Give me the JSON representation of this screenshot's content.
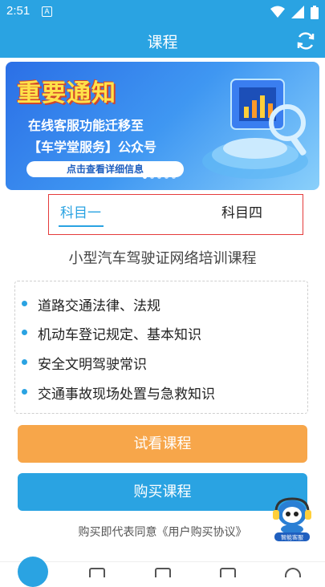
{
  "status_bar": {
    "time": "2:51",
    "notification_badge": "A",
    "icons": [
      "wifi-icon",
      "signal-icon",
      "battery-icon"
    ]
  },
  "app_bar": {
    "title": "课程",
    "refresh_icon": "refresh-icon"
  },
  "banner": {
    "headline": "重要通知",
    "line1": "在线客服功能迁移至",
    "line2": "【车学堂服务】公众号",
    "button_label": "点击查看详细信息",
    "slide_count": 5,
    "active_slide": 0
  },
  "tabs": [
    {
      "label": "科目一",
      "active": true
    },
    {
      "label": "科目四",
      "active": false
    }
  ],
  "course_title": "小型汽车驾驶证网络培训课程",
  "topics": [
    "道路交通法律、法规",
    "机动车登记规定、基本知识",
    "安全文明驾驶常识",
    "交通事故现场处置与急救知识"
  ],
  "buttons": {
    "trial": "试看课程",
    "buy": "购买课程"
  },
  "agreement": {
    "prefix": "购买即代表同意",
    "link": "《用户购买协议》"
  },
  "mascot_label": "智能客服",
  "colors": {
    "primary": "#2aa3e2",
    "accent_orange": "#f7a64a",
    "highlight_red": "#e53b3b"
  }
}
